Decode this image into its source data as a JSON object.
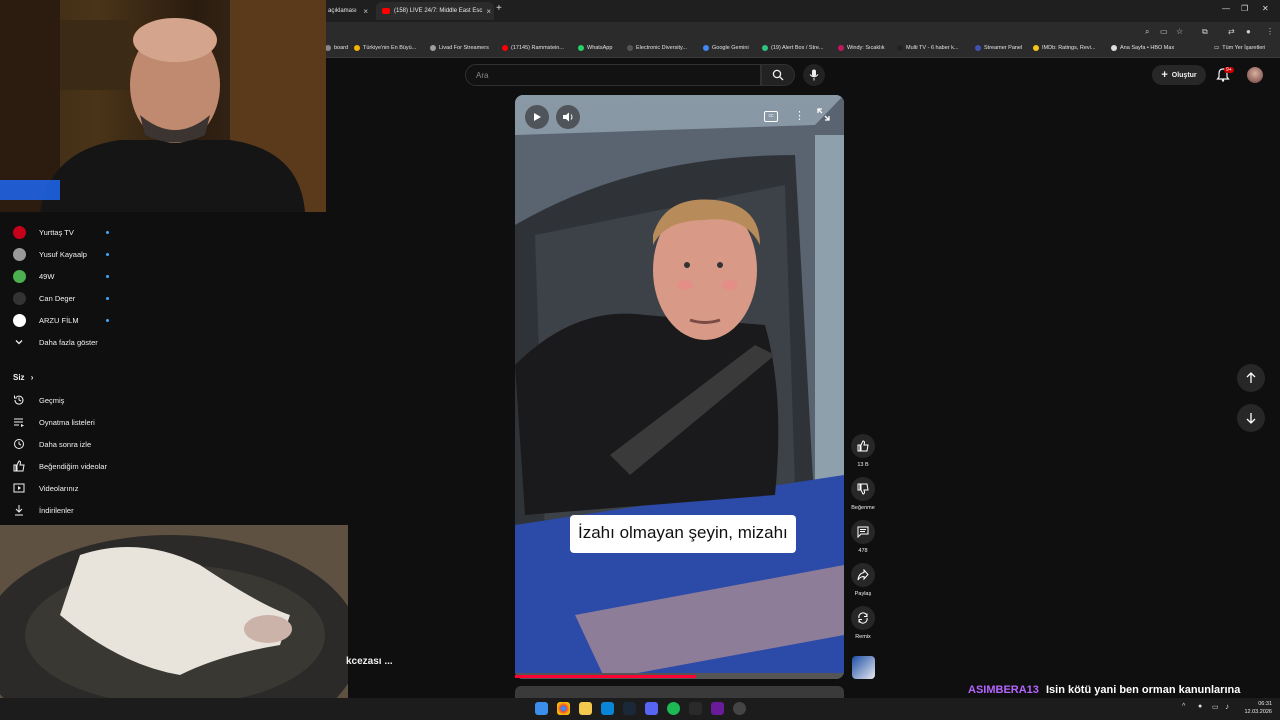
{
  "tabs": [
    {
      "label": "açıklaması"
    },
    {
      "label": "(158) LIVE 24/7: Middle East Esc"
    }
  ],
  "bookmarks": [
    {
      "label": "board",
      "color": "#888888"
    },
    {
      "label": "Türkiye'nin En Büyü...",
      "color": "#f4b400"
    },
    {
      "label": "Livad For Streamers",
      "color": "#9e9e9e"
    },
    {
      "label": "(17145) Rammstein...",
      "color": "#ff0000"
    },
    {
      "label": "WhatsApp",
      "color": "#25d366"
    },
    {
      "label": "Electronic Diversity...",
      "color": "#555555"
    },
    {
      "label": "Google Gemini",
      "color": "#4285f4"
    },
    {
      "label": "(19) Alert Box / Stre...",
      "color": "#31c27c"
    },
    {
      "label": "Windy: Sıcaklık",
      "color": "#c2185b"
    },
    {
      "label": "Multi TV - 6 haber k...",
      "color": "#222222"
    },
    {
      "label": "Streamer Panel",
      "color": "#3f51b5"
    },
    {
      "label": "IMDb: Ratings, Revi...",
      "color": "#f5c518"
    },
    {
      "label": "Ana Sayfa • HBO Max",
      "color": "#dddddd"
    }
  ],
  "bookmarks_other": "Tüm Yer İşaretleri",
  "header": {
    "search_placeholder": "Ara",
    "create_label": "Oluştur",
    "notif_count": "9+"
  },
  "sidebar": {
    "subscriptions": [
      {
        "label": "Yurttaş TV",
        "color": "#c4001a"
      },
      {
        "label": "Yusuf Kayaalp",
        "color": "#9a9a9a"
      },
      {
        "label": "49W",
        "color": "#4caf50"
      },
      {
        "label": "Can Deger",
        "color": "#333333"
      },
      {
        "label": "ARZU FİLM",
        "color": "#ffffff"
      }
    ],
    "show_more": "Daha fazla göster",
    "you_label": "Siz",
    "you_items": [
      {
        "label": "Geçmiş",
        "icon": "history-icon"
      },
      {
        "label": "Oynatma listeleri",
        "icon": "playlists-icon"
      },
      {
        "label": "Daha sonra izle",
        "icon": "clock-icon"
      },
      {
        "label": "Beğendiğim videolar",
        "icon": "like-icon"
      },
      {
        "label": "Videolarınız",
        "icon": "video-icon"
      },
      {
        "label": "İndirilenler",
        "icon": "download-icon"
      }
    ]
  },
  "video": {
    "caption": "İzahı olmayan şeyin, mizahı",
    "progress": 0.55
  },
  "actions": {
    "likes": "13 B",
    "dislike": "Beğenme",
    "comments": "478",
    "share": "Paylaş",
    "remix": "Remix"
  },
  "short_title_fragment": "kcezası ...",
  "chat": {
    "user": "ASIMBERA13",
    "message": "Isin kötü yani ben orman kanunlarına adapte oldum"
  },
  "clock": {
    "time": "06:31",
    "date": "12.03.2026"
  }
}
